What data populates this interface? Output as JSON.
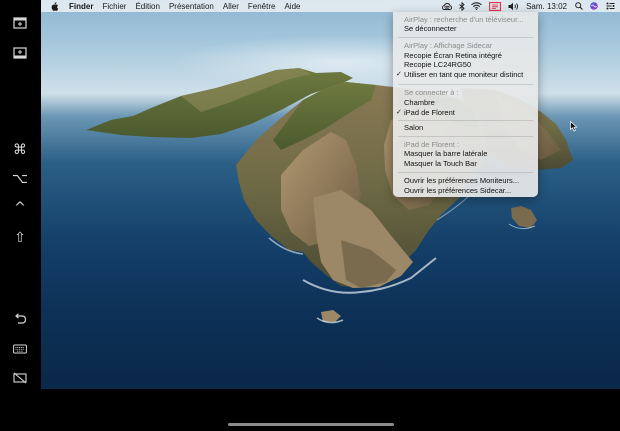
{
  "sidecar_bar": {
    "buttons": [
      {
        "name": "show-menubar-button",
        "icon": "menubar-icon"
      },
      {
        "name": "show-dock-button",
        "icon": "dock-icon"
      },
      {
        "name": "command-key-button",
        "icon": "command-icon",
        "glyph": "⌘"
      },
      {
        "name": "option-key-button",
        "icon": "option-icon",
        "glyph": "⌥"
      },
      {
        "name": "control-key-button",
        "icon": "control-icon",
        "glyph": "^"
      },
      {
        "name": "shift-key-button",
        "icon": "shift-icon",
        "glyph": "⇧"
      },
      {
        "name": "undo-button",
        "icon": "undo-icon"
      },
      {
        "name": "keyboard-button",
        "icon": "keyboard-icon"
      },
      {
        "name": "disconnect-button",
        "icon": "disconnect-icon"
      }
    ]
  },
  "menubar": {
    "app_name": "Finder",
    "items": [
      "Fichier",
      "Édition",
      "Présentation",
      "Aller",
      "Fenêtre",
      "Aide"
    ],
    "clock": "Sam. 13:02",
    "status_icons": [
      "creative-cloud-icon",
      "bluetooth-icon",
      "wifi-icon",
      "airplay-display-icon",
      "volume-icon",
      "search-icon",
      "siri-icon",
      "control-center-icon"
    ]
  },
  "display_menu": {
    "sections": [
      {
        "header": "AirPlay : recherche d'un téléviseur...",
        "items": [
          {
            "label": "Se déconnecter",
            "checked": false
          }
        ]
      },
      {
        "header": "AirPlay : Affichage Sidecar",
        "items": [
          {
            "label": "Recopie Écran Retina intégré",
            "checked": false
          },
          {
            "label": "Recopie LC24RG50",
            "checked": false
          },
          {
            "label": "Utiliser en tant que moniteur distinct",
            "checked": true
          }
        ]
      },
      {
        "header": "Se connecter à :",
        "items": [
          {
            "label": "Chambre",
            "checked": false
          },
          {
            "label": "iPad de Florent",
            "checked": true
          }
        ]
      },
      {
        "header": null,
        "items": [
          {
            "label": "Salon",
            "checked": false
          }
        ]
      },
      {
        "header": "iPad de Florent :",
        "items": [
          {
            "label": "Masquer la barre latérale",
            "checked": false
          },
          {
            "label": "Masquer la Touch Bar",
            "checked": false
          }
        ]
      },
      {
        "header": null,
        "items": [
          {
            "label": "Ouvrir les préférences Moniteurs...",
            "checked": false
          },
          {
            "label": "Ouvrir les préférences Sidecar...",
            "checked": false
          }
        ]
      }
    ]
  },
  "colors": {
    "menubar_bg": "#e8eef3",
    "menu_bg": "#e7e8e8",
    "disabled_text": "#8c8c8c",
    "ocean": "#14406a"
  }
}
